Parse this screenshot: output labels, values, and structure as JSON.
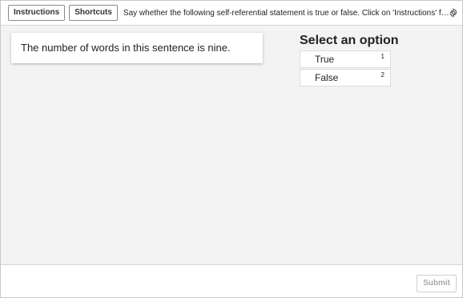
{
  "toolbar": {
    "instructions_label": "Instructions",
    "shortcuts_label": "Shortcuts",
    "task_text": "Say whether the following self-referential statement is true or false. Click on 'Instructions' for detailed instructions.",
    "settings_icon": "gear-icon"
  },
  "statement": {
    "text": "The number of words in this sentence is nine."
  },
  "options": {
    "title": "Select an option",
    "items": [
      {
        "label": "True",
        "key": "1"
      },
      {
        "label": "False",
        "key": "2"
      }
    ]
  },
  "footer": {
    "submit_label": "Submit"
  },
  "colors": {
    "workspace_bg": "#f2f3f2",
    "submit_disabled_text": "#a8a8a8"
  }
}
